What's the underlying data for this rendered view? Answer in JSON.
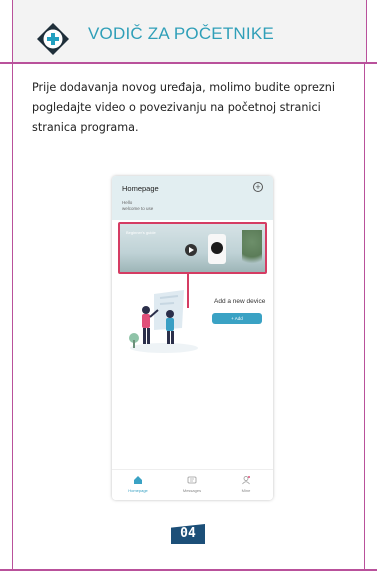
{
  "header": {
    "icon": "plus-badge-icon",
    "title": "VODIČ ZA POČETNIKE",
    "accent_color": "#2f9fb8",
    "frame_color": "#b9519b"
  },
  "intro": {
    "text": "Prije dodavanja novog uređaja, molimo budite oprezni pogledajte video o povezivanju na početnoj stranici stranica programa."
  },
  "phone": {
    "title": "Homepage",
    "add_icon": "plus-circle-icon",
    "greeting": "Hello",
    "welcome": "welcome to use",
    "video_label": "Beginner's guide",
    "highlight_color": "#d53c63",
    "add_device_text": "Add a new device",
    "add_button": "+ Add",
    "tabs": [
      {
        "label": "Homepage",
        "icon": "home-icon"
      },
      {
        "label": "Messages",
        "icon": "message-icon"
      },
      {
        "label": "Mine",
        "icon": "profile-icon"
      }
    ]
  },
  "footer": {
    "page_number": "04"
  }
}
